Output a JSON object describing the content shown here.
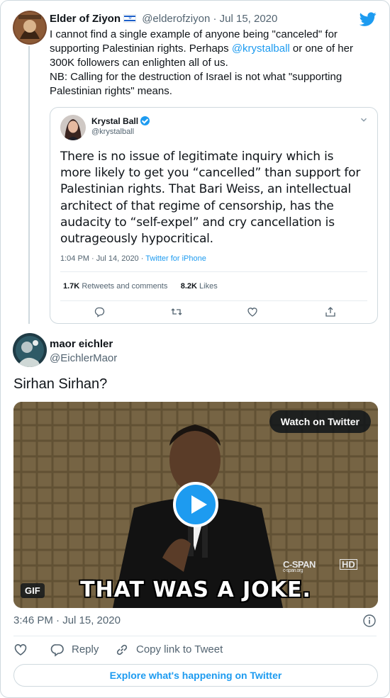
{
  "parent_tweet": {
    "author_name": "Elder of Ziyon",
    "author_handle": "@elderofziyon",
    "date": "Jul 15, 2020",
    "text_parts": {
      "before_mention": "I cannot find a single example of anyone being \"canceled\" for supporting Palestinian rights. Perhaps ",
      "mention": "@krystalball",
      "after_mention": " or one of her 300K followers can enlighten all of us.",
      "note": "NB: Calling for the destruction of Israel is not what \"supporting Palestinian rights\" means."
    },
    "flag_icon": "israel-flag-icon",
    "separator": "·"
  },
  "quoted_tweet": {
    "author_name": "Krystal Ball",
    "author_handle": "@krystalball",
    "text": "There is no issue of legitimate inquiry which is more likely to get you “cancelled” than support for Palestinian rights. That Bari Weiss, an intellectual architect of that regime of censorship, has the audacity to “self-expel” and cry cancellation is outrageously hypocritical.",
    "time": "1:04 PM · Jul 14, 2020 · ",
    "source": "Twitter for iPhone",
    "retweets_count": "1.7K",
    "retweets_label": "Retweets and comments",
    "likes_count": "8.2K",
    "likes_label": "Likes"
  },
  "reply_tweet": {
    "author_name": "maor eichler",
    "author_handle": "@EichlerMaor",
    "text": "Sirhan Sirhan?",
    "media": {
      "watch_label": "Watch on Twitter",
      "gif_badge": "GIF",
      "caption": "THAT WAS A JOKE.",
      "network_logo": "C-SPAN",
      "network_sub": "c-span.org",
      "hd_label": "HD"
    },
    "timestamp": "3:46 PM · Jul 15, 2020",
    "actions": {
      "reply": "Reply",
      "copy_link": "Copy link to Tweet"
    },
    "explore_label": "Explore what's happening on Twitter"
  },
  "colors": {
    "accent": "#1d9bf0",
    "text": "#0f1419",
    "muted": "#536471",
    "border": "#cfd9de"
  }
}
